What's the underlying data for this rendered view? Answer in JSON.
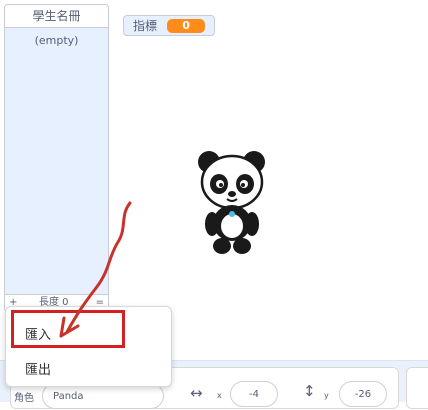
{
  "list_monitor": {
    "title": "學生名冊",
    "empty_text": "(empty)",
    "add_button": "+",
    "length_label": "長度 0",
    "resize_button": "="
  },
  "variable_monitor": {
    "label": "指標",
    "value": "0",
    "accent_color": "#ff8c1a"
  },
  "context_menu": {
    "import_label": "匯入",
    "export_label": "匯出",
    "highlight_color": "#d42020"
  },
  "sprite_info": {
    "sprite_label": "角色",
    "sprite_name": "Panda",
    "x_label": "x",
    "x_value": "-4",
    "y_label": "y",
    "y_value": "-26"
  },
  "icons": {
    "x_icon": "horizontal-arrows-icon",
    "y_icon": "vertical-arrow-icon"
  }
}
